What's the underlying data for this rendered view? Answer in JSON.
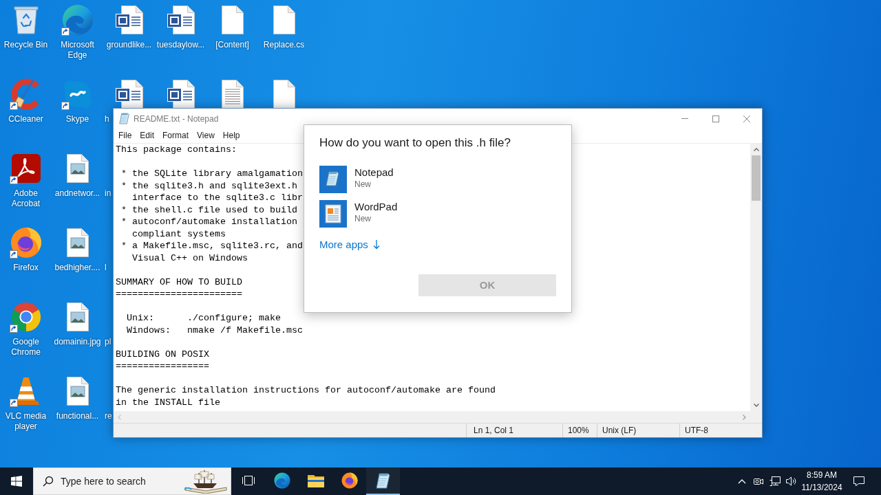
{
  "desktop": {
    "columns": [
      {
        "icons": [
          {
            "label": "Recycle Bin",
            "kind": "recycle-bin",
            "covered": false
          },
          {
            "label": "CCleaner",
            "kind": "ccleaner",
            "shortcut": true,
            "covered": false
          },
          {
            "label": "Adobe Acrobat",
            "kind": "acrobat",
            "shortcut": true,
            "covered": false
          },
          {
            "label": "Firefox",
            "kind": "firefox",
            "shortcut": true,
            "covered": false
          },
          {
            "label": "Google Chrome",
            "kind": "chrome",
            "shortcut": true,
            "covered": false
          },
          {
            "label": "VLC media player",
            "kind": "vlc",
            "shortcut": true,
            "covered": false
          }
        ]
      },
      {
        "icons": [
          {
            "label": "Microsoft Edge",
            "kind": "edge",
            "shortcut": true,
            "covered": false
          },
          {
            "label": "Skype",
            "kind": "skype",
            "shortcut": true,
            "covered": false
          },
          {
            "label": "andnetwor...",
            "kind": "image",
            "covered": false
          },
          {
            "label": "bedhigher....",
            "kind": "image",
            "covered": false
          },
          {
            "label": "domainin.jpg",
            "kind": "image",
            "covered": false
          },
          {
            "label": "functional...",
            "kind": "image",
            "covered": false
          }
        ]
      },
      {
        "icons": [
          {
            "label": "groundlike...",
            "kind": "word",
            "covered": false
          },
          {
            "label": "h",
            "kind": "word",
            "covered": true
          },
          {
            "label": "in",
            "covered": true
          },
          {
            "label": "l",
            "covered": true
          },
          {
            "label": "pl",
            "covered": true
          },
          {
            "label": "re",
            "covered": true
          }
        ]
      },
      {
        "icons": [
          {
            "label": "tuesdaylow...",
            "kind": "word",
            "covered": false
          },
          {
            "kind": "word",
            "covered": false
          }
        ]
      },
      {
        "icons": [
          {
            "label": "[Content]",
            "kind": "blank",
            "covered": false
          },
          {
            "kind": "text",
            "covered": false
          }
        ]
      },
      {
        "icons": [
          {
            "label": "Replace.cs",
            "kind": "blank",
            "covered": false
          },
          {
            "kind": "blank",
            "covered": false
          }
        ]
      }
    ]
  },
  "notepad": {
    "title": "README.txt - Notepad",
    "active": false,
    "menu": [
      "File",
      "Edit",
      "Format",
      "View",
      "Help"
    ],
    "paragraphs": [
      [
        "This package contains:"
      ],
      [
        " * the SQLite library amalgamation",
        " * the sqlite3.h and sqlite3ext.h",
        "   interface to the sqlite3.c libr",
        " * the shell.c file used to build",
        " * autoconf/automake installation",
        "   compliant systems",
        " * a Makefile.msc, sqlite3.rc, and",
        "   Visual C++ on Windows"
      ],
      [
        "SUMMARY OF HOW TO BUILD",
        "======================="
      ],
      [
        "  Unix:      ./configure; make",
        "  Windows:   nmake /f Makefile.msc"
      ],
      [
        "BUILDING ON POSIX",
        "================="
      ],
      [
        "The generic installation instructions for autoconf/automake are found",
        "in the INSTALL file"
      ]
    ],
    "status_bar": [
      "Ln 1, Col 1",
      "100%",
      "Unix (LF)",
      "UTF-8"
    ]
  },
  "dialog": {
    "title": "How do you want to open this .h file?",
    "apps": [
      {
        "name": "Notepad",
        "note": "New",
        "kind": "notepad",
        "selected": false
      },
      {
        "name": "WordPad",
        "note": "New",
        "kind": "wordpad",
        "selected": false
      }
    ],
    "more_apps": "More apps",
    "ok_button": {
      "label": "OK",
      "disabled": true
    }
  },
  "taskbar": {
    "search": {
      "placeholder": "Type here to search"
    },
    "apps": [
      {
        "kind": "task-view",
        "active": false
      },
      {
        "kind": "edge",
        "active": false
      },
      {
        "kind": "explorer",
        "active": false
      },
      {
        "kind": "firefox",
        "active": false
      },
      {
        "kind": "notepad",
        "active": true
      }
    ],
    "clock": {
      "time": "8:59 AM",
      "date": "11/13/2024"
    }
  }
}
